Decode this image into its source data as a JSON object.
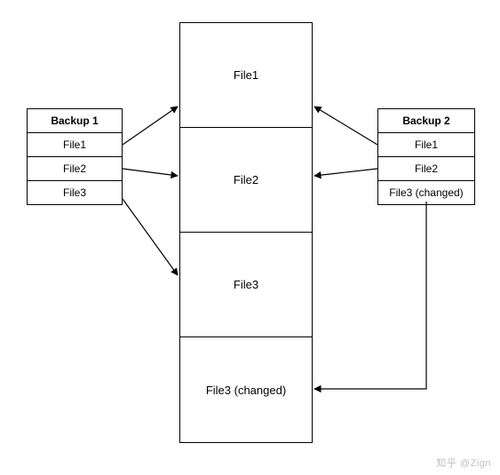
{
  "backup1": {
    "title": "Backup 1",
    "rows": [
      "File1",
      "File2",
      "File3"
    ]
  },
  "backup2": {
    "title": "Backup 2",
    "rows": [
      "File1",
      "File2",
      "File3 (changed)"
    ]
  },
  "center": {
    "rows": [
      "File1",
      "File2",
      "File3",
      "File3 (changed)"
    ]
  },
  "watermark": "知乎 @Zign",
  "chart_data": {
    "type": "diagram",
    "title": "",
    "nodes": [
      {
        "id": "backup1",
        "label": "Backup 1",
        "items": [
          "File1",
          "File2",
          "File3"
        ]
      },
      {
        "id": "backup2",
        "label": "Backup 2",
        "items": [
          "File1",
          "File2",
          "File3 (changed)"
        ]
      },
      {
        "id": "store",
        "label": "",
        "items": [
          "File1",
          "File2",
          "File3",
          "File3 (changed)"
        ]
      }
    ],
    "edges": [
      {
        "from": "backup1.File1",
        "to": "store.File1"
      },
      {
        "from": "backup1.File2",
        "to": "store.File2"
      },
      {
        "from": "backup1.File3",
        "to": "store.File3"
      },
      {
        "from": "backup2.File1",
        "to": "store.File1"
      },
      {
        "from": "backup2.File2",
        "to": "store.File2"
      },
      {
        "from": "backup2.File3 (changed)",
        "to": "store.File3 (changed)"
      }
    ]
  }
}
